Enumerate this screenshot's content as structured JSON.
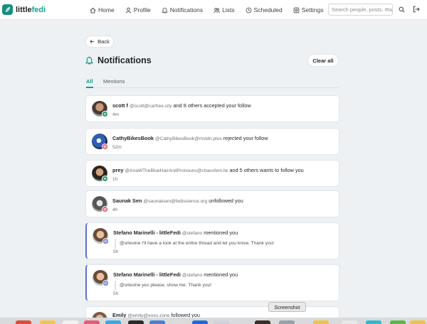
{
  "app": {
    "logo_prefix": "little",
    "logo_suffix": "fedi"
  },
  "nav": {
    "items": [
      {
        "label": "Home",
        "icon": "home-icon"
      },
      {
        "label": "Profile",
        "icon": "user-icon"
      },
      {
        "label": "Notifications",
        "icon": "bell-icon"
      },
      {
        "label": "Lists",
        "icon": "users-icon"
      },
      {
        "label": "Scheduled",
        "icon": "clock-icon"
      },
      {
        "label": "Settings",
        "icon": "gear-icon"
      }
    ],
    "search_placeholder": "Search people, posts, #tag"
  },
  "page": {
    "back_label": "Back",
    "title": "Notifications",
    "clear_label": "Clear all",
    "tabs": [
      {
        "label": "All",
        "active": true
      },
      {
        "label": "Mentions",
        "active": false
      }
    ]
  },
  "notifications": [
    {
      "name": "scott f",
      "handle": "@scott@carfree.city",
      "others": " and 8 others",
      "action": " accepted your follow",
      "time": "4m"
    },
    {
      "name": "CathyBikesBook",
      "handle": "@CathyBikesBook@mstdn.plus",
      "others": "",
      "action": " rejected your follow",
      "time": "52m"
    },
    {
      "name": "prey",
      "handle": "@AnaWTheBlueHairAndPronouns@chaosfem.tw",
      "others": " and 5 others",
      "action": " wants to follow you",
      "time": "1h"
    },
    {
      "name": "Saunak Sen",
      "handle": "@saunaksen@fediscience.org",
      "others": "",
      "action": " unfollowed you",
      "time": "4h"
    },
    {
      "name": "Stefano Marinelli - littleFedi",
      "handle": "@stefano",
      "others": "",
      "action": " mentioned you",
      "quote": "@srlevine I'll have a look at the entire thread and let you know. Thank you!",
      "time": "5h"
    },
    {
      "name": "Stefano Marinelli - littleFedi",
      "handle": "@stefano",
      "others": "",
      "action": " mentioned you",
      "quote": "@srlevine yes please, show me. Thank you!",
      "time": "5h"
    },
    {
      "name": "Emily",
      "handle": "@emily@xoxo.zone",
      "others": "",
      "action": " followed you",
      "time": ""
    }
  ],
  "dock": {
    "tooltip": "Screenshot"
  },
  "colors": {
    "accent": "#139784",
    "mention_border": "#5b6fd6",
    "badge_follow": "#2e9c6a",
    "badge_reject": "#d9485f"
  }
}
